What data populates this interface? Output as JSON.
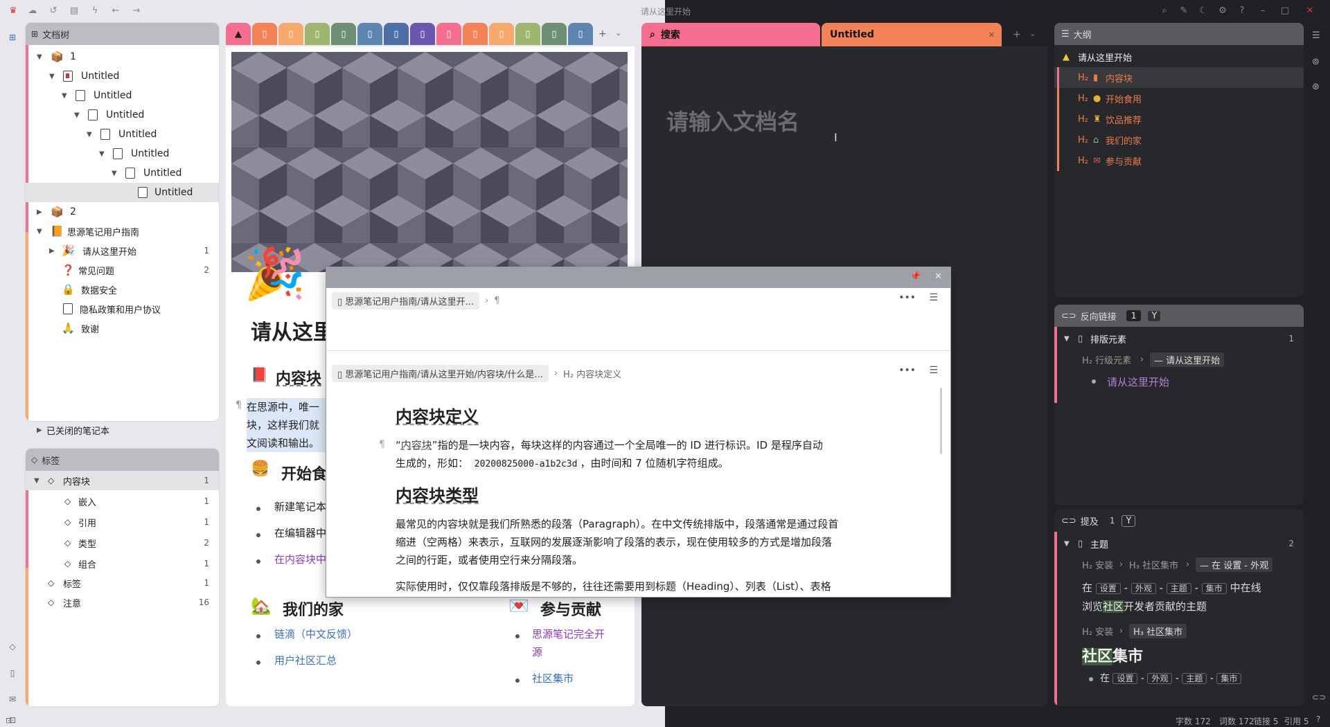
{
  "window": {
    "title": "请从这里开始"
  },
  "doctree": {
    "title": "文档树",
    "rows": [
      {
        "label": "1"
      },
      {
        "label": "Untitled"
      },
      {
        "label": "Untitled"
      },
      {
        "label": "Untitled"
      },
      {
        "label": "Untitled"
      },
      {
        "label": "Untitled"
      },
      {
        "label": "Untitled"
      },
      {
        "label": "Untitled"
      },
      {
        "label": "2"
      },
      {
        "label": "思源笔记用户指南"
      },
      {
        "label": "请从这里开始",
        "count": "1"
      },
      {
        "label": "常见问题",
        "count": "2"
      },
      {
        "label": "数据安全"
      },
      {
        "label": "隐私政策和用户协议"
      },
      {
        "label": "致谢"
      }
    ],
    "closed_notebooks": "已关闭的笔记本"
  },
  "tags": {
    "title": "标签",
    "rows": [
      {
        "label": "内容块",
        "count": "1"
      },
      {
        "label": "嵌入",
        "count": "1"
      },
      {
        "label": "引用",
        "count": "1"
      },
      {
        "label": "类型",
        "count": "2"
      },
      {
        "label": "组合",
        "count": "1"
      },
      {
        "label": "标签",
        "count": "1"
      },
      {
        "label": "注意",
        "count": "16"
      }
    ]
  },
  "editor": {
    "doc_title": "请从这里",
    "h2_block": "内容块",
    "para_lines": [
      "在思源中，唯一",
      "块，这样我们就",
      "文阅读和输出。"
    ],
    "h2_start": "开始食",
    "start_items": [
      "新建笔记本",
      "在编辑器中",
      "在内容块中"
    ],
    "h2_home": "我们的家",
    "home_links": [
      "链滴（中文反馈）",
      "用户社区汇总"
    ],
    "h2_contrib": "参与贡献",
    "contrib_links": [
      "思源笔记完全开",
      "源",
      "社区集市"
    ]
  },
  "popup": {
    "crumb1": "思源笔记用户指南/请从这里开...",
    "crumb2": "思源笔记用户指南/请从这里开始/内容块/什么是...",
    "crumb2_tail": "H₂ 内容块定义",
    "h_def": "内容块定义",
    "def_line1_a": "“",
    "def_line1_b": "内容块",
    "def_line1_c": "”指的是一块内容，每块这样的内容通过一个全局唯一的 ID 进行标识。ID 是程序自动",
    "def_line2_a": "生成的，形如：",
    "def_code": "20200825000-a1b2c3d",
    "def_line2_b": "，由时间和 7 位随机字符组成。",
    "h_types": "内容块类型",
    "types_line1": "最常见的内容块就是我们所熟悉的段落（Paragraph）。在中文传统排版中，段落通常是通过段首",
    "types_line2": "缩进（空两格）来表示，互联网的发展逐渐影响了段落的表示，现在使用较多的方式是增加段落",
    "types_line3": "之间的行距，或者使用空行来分隔段落。",
    "types_line4": "实际使用时，仅仅靠段落排版是不够的，往往还需要用到标题（Heading）、列表（List）、表格"
  },
  "right_tabs": {
    "search": "搜索",
    "untitled": "Untitled"
  },
  "untitled_doc": {
    "placeholder": "请输入文档名"
  },
  "outline": {
    "title": "大纲",
    "root": "请从这里开始",
    "items": [
      "内容块",
      "开始食用",
      "饮品推荐",
      "我们的家",
      "参与贡献"
    ],
    "h_marker": "H₂"
  },
  "backlinks": {
    "title": "反向链接",
    "count": "1",
    "group": "排版元素",
    "group_count": "1",
    "path_h": "H₂ 行级元素",
    "path_chip": "— 请从这里开始",
    "item": "请从这里开始"
  },
  "mentions": {
    "title": "提及",
    "count": "1",
    "group": "主题",
    "group_count": "2",
    "path1_a": "H₂ 安装",
    "path1_b": "H₃ 社区集市",
    "path1_chip": "— 在 设置 - 外观",
    "line1_a": "在",
    "kbd_settings": "设置",
    "kbd_appearance": "外观",
    "kbd_theme": "主题",
    "kbd_market": "集市",
    "line1_b": "中在线",
    "line2_a": "浏览",
    "line2_hl": "社区",
    "line2_b": "开发者贡献的主题",
    "path2_a": "H₂ 安装",
    "path2_b": "H₃ 社区集市",
    "big_title_hl": "社区",
    "big_title_b": "集市",
    "bullet_a": "在",
    "dash": "-"
  },
  "status": {
    "chars": "字数 172",
    "words": "词数 172",
    "links": "链接 5",
    "refs": "引用 5"
  }
}
